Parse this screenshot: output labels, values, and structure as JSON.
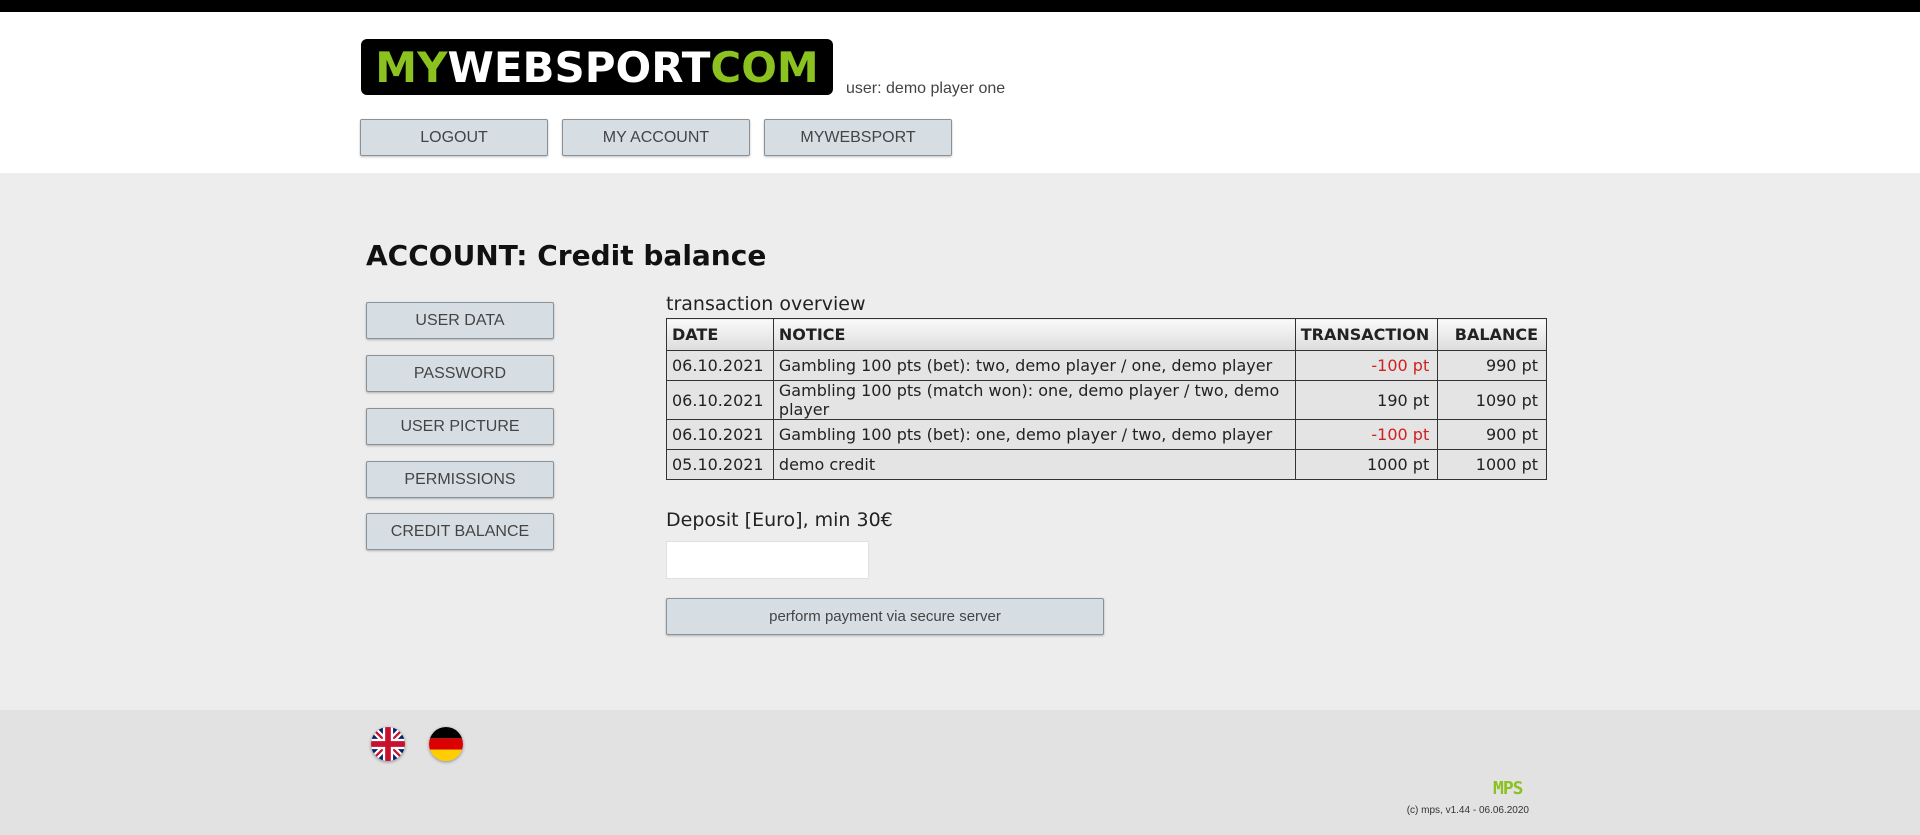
{
  "header": {
    "logo_part1": "MY",
    "logo_part2": "WEBSPORT",
    "logo_part3": "COM",
    "user_label": "user: demo player one",
    "nav": {
      "logout": "LOGOUT",
      "my_account": "MY ACCOUNT",
      "mywebsport": "MYWEBSPORT"
    }
  },
  "main": {
    "title": "ACCOUNT: Credit balance",
    "sidebar": {
      "user_data": "USER DATA",
      "password": "PASSWORD",
      "user_picture": "USER PICTURE",
      "permissions": "PERMISSIONS",
      "credit_balance": "CREDIT BALANCE"
    },
    "transactions": {
      "label": "transaction overview",
      "headers": {
        "date": "DATE",
        "notice": "NOTICE",
        "transaction": "TRANSACTION",
        "balance": "BALANCE"
      },
      "rows": [
        {
          "date": "06.10.2021",
          "notice": "Gambling 100 pts (bet): two, demo player / one, demo player",
          "transaction": "-100 pt",
          "balance": "990 pt"
        },
        {
          "date": "06.10.2021",
          "notice": "Gambling 100 pts (match won): one, demo player / two, demo player",
          "transaction": "190 pt",
          "balance": "1090 pt"
        },
        {
          "date": "06.10.2021",
          "notice": "Gambling 100 pts (bet): one, demo player / two, demo player",
          "transaction": "-100 pt",
          "balance": "900 pt"
        },
        {
          "date": "05.10.2021",
          "notice": "demo credit",
          "transaction": "1000 pt",
          "balance": "1000 pt"
        }
      ]
    },
    "deposit": {
      "label": "Deposit [Euro], min 30€",
      "value": "",
      "button": "perform payment via secure server"
    }
  },
  "footer": {
    "languages": [
      "english-flag",
      "german-flag"
    ],
    "brand": "MPS",
    "version": "(c) mps, v1.44 - 06.06.2020"
  },
  "colors": {
    "accent": "#8cc21f",
    "negative": "#d02020",
    "button": "#d7dee3"
  }
}
